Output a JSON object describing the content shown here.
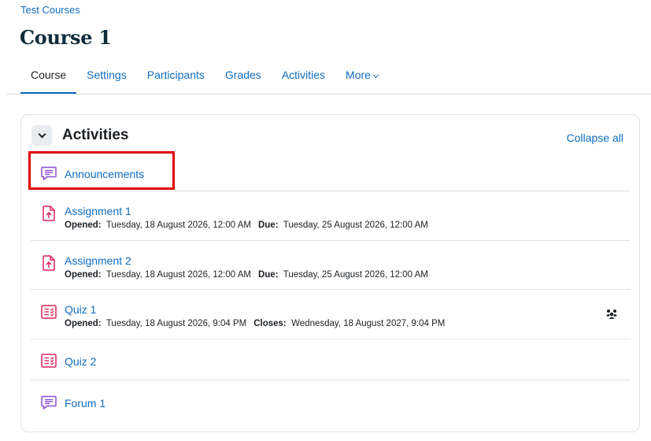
{
  "breadcrumb": "Test Courses",
  "page_title": "Course 1",
  "tabs": [
    {
      "label": "Course",
      "active": true
    },
    {
      "label": "Settings"
    },
    {
      "label": "Participants"
    },
    {
      "label": "Grades"
    },
    {
      "label": "Activities"
    },
    {
      "label": "More"
    }
  ],
  "section": {
    "title": "Activities",
    "collapse_all": "Collapse all"
  },
  "activities": [
    {
      "name": "Announcements",
      "type": "forum",
      "icon": "forum-icon"
    },
    {
      "name": "Assignment 1",
      "type": "assign",
      "icon": "assignment-icon",
      "opened_label": "Opened:",
      "opened": "Tuesday, 18 August 2026, 12:00 AM",
      "due_label": "Due:",
      "due": "Tuesday, 25 August 2026, 12:00 AM"
    },
    {
      "name": "Assignment 2",
      "type": "assign",
      "icon": "assignment-icon",
      "opened_label": "Opened:",
      "opened": "Tuesday, 18 August 2026, 12:00 AM",
      "due_label": "Due:",
      "due": "Tuesday, 25 August 2026, 12:00 AM"
    },
    {
      "name": "Quiz 1",
      "type": "quiz",
      "icon": "quiz-icon",
      "opened_label": "Opened:",
      "opened": "Tuesday, 18 August 2026, 9:04 PM",
      "closes_label": "Closes:",
      "closes": "Wednesday, 18 August 2027, 9:04 PM",
      "group_icon": "group-mode-icon"
    },
    {
      "name": "Quiz 2",
      "type": "quiz",
      "icon": "quiz-icon"
    },
    {
      "name": "Forum 1",
      "type": "forum",
      "icon": "forum-icon"
    }
  ],
  "colors": {
    "link": "#0f6cbf",
    "forum_icon": "#8f4bd6",
    "assign_quiz_icon": "#e0245e",
    "highlight": "#e00000"
  }
}
